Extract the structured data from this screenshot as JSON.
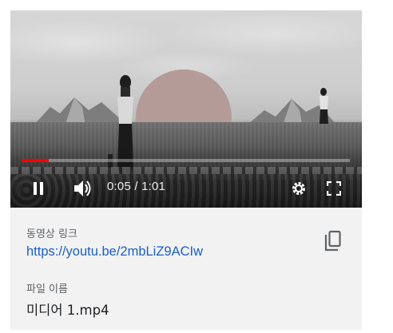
{
  "player": {
    "time_display": "0:05 / 1:01",
    "progress_fraction": 0.082,
    "accent_color": "#ff0000",
    "controls": {
      "play_pause_icon": "pause-icon",
      "volume_icon": "volume-icon",
      "settings_icon": "gear-icon",
      "fullscreen_icon": "fullscreen-icon"
    }
  },
  "info": {
    "video_link_label": "동영상 링크",
    "video_link_url": "https://youtu.be/2mbLiZ9ACIw",
    "copy_icon": "copy-icon",
    "file_name_label": "파일 이름",
    "file_name_value": "미디어 1.mp4"
  },
  "colors": {
    "link": "#1a5fc9",
    "label": "#5f6368",
    "card_background": "#f2f2f2"
  }
}
